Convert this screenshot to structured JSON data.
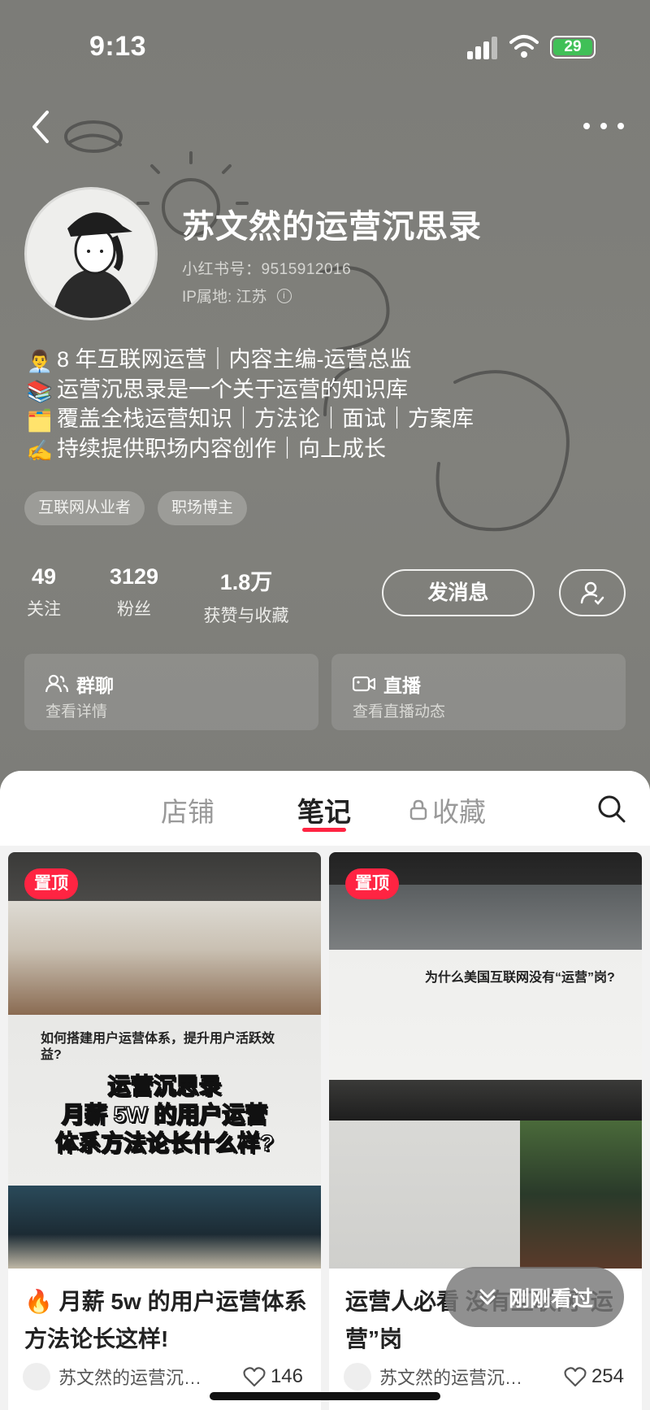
{
  "status": {
    "time": "9:13",
    "battery": "29"
  },
  "profile": {
    "nickname": "苏文然的运营沉思录",
    "red_id": "小红书号：9515912016",
    "ip": "IP属地: 江苏",
    "bio": [
      {
        "emoji": "👨‍💼",
        "text": "8 年互联网运营｜内容主编-运营总监"
      },
      {
        "emoji": "📚",
        "text": "运营沉思录是一个关于运营的知识库"
      },
      {
        "emoji": "🗂️",
        "text": "覆盖全栈运营知识｜方法论｜面试｜方案库"
      },
      {
        "emoji": "✍️",
        "text": "持续提供职场内容创作｜向上成长"
      }
    ],
    "tags": [
      "互联网从业者",
      "职场博主"
    ],
    "stats": [
      {
        "num": "49",
        "label": "关注"
      },
      {
        "num": "3129",
        "label": "粉丝"
      },
      {
        "num": "1.8万",
        "label": "获赞与收藏"
      }
    ],
    "message_label": "发消息"
  },
  "cards": [
    {
      "title": "群聊",
      "sub": "查看详情",
      "icon": "group-icon"
    },
    {
      "title": "直播",
      "sub": "查看直播动态",
      "icon": "live-icon"
    }
  ],
  "tabs": [
    "店铺",
    "笔记",
    "收藏"
  ],
  "active_tab": "笔记",
  "notes": [
    {
      "pin": "置顶",
      "title_emoji": "🔥",
      "title": "月薪 5w 的用户运营体系方法论长这样!",
      "image_heading": "如何搭建用户运营体系，提升用户活跃效益?",
      "overlay": [
        "运营沉思录",
        "月薪 5W 的用户运营",
        "体系方法论长什么样?"
      ],
      "author": "苏文然的运营沉…",
      "likes": "146"
    },
    {
      "pin": "置顶",
      "title": "运营人必看 没有互联网“运营”岗",
      "image_heading": "为什么美国互联网没有“运营”岗?",
      "author": "苏文然的运营沉…",
      "likes": "254"
    }
  ],
  "recently_viewed": "刚刚看过"
}
